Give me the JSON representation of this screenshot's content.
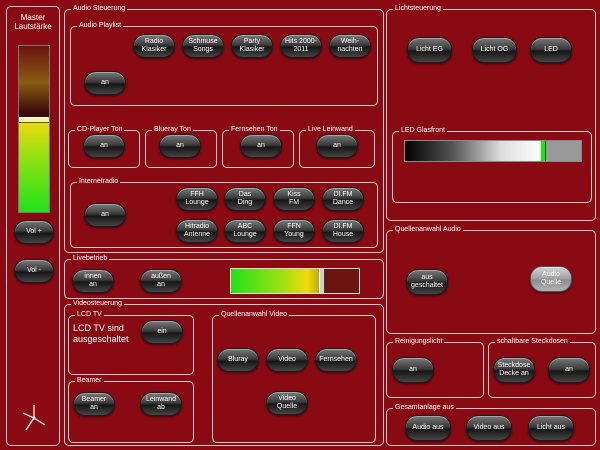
{
  "master": {
    "title": "Master\nLautstärke",
    "volume_level": 0.55,
    "vol_plus": "Vol +",
    "vol_minus": "Vol -"
  },
  "audio": {
    "title": "Audio Steuerung",
    "playlist": {
      "title": "Audio Playlist",
      "buttons": [
        "Radio\nKlasiker",
        "Schmuse\nSongs",
        "Party\nKlasiker",
        "Hits 2000-\n2011",
        "Weih-\nnachten"
      ],
      "on": "an"
    },
    "cd": {
      "title": "CD-Player Ton",
      "on": "an"
    },
    "bluray": {
      "title": "Blueray Ton",
      "on": "an"
    },
    "tv": {
      "title": "Fernsehen Ton",
      "on": "an"
    },
    "wall": {
      "title": "Live Leinwand",
      "on": "an"
    },
    "radio": {
      "title": "Internetradio",
      "on": "an",
      "buttons": [
        "FFH\nLounge",
        "Das\nDing",
        "Kiss\nFM",
        "DI.FM\nDance",
        "Hitradio\nAntenne",
        "ABC\nLounge",
        "FFN\nYoung",
        "DI.FM\nHouse"
      ]
    }
  },
  "live": {
    "title": "Livebetrieb",
    "inside": "innen\nan",
    "outside": "außen\nan",
    "level": 0.7
  },
  "video": {
    "title": "Videosteuerung",
    "lcd": {
      "title": "LCD TV",
      "status": "LCD TV sind\nausgeschaltet",
      "on": "ein"
    },
    "beamer": {
      "title": "Beamer",
      "on": "Beamer\nan",
      "screen": "Leinwand\nab"
    },
    "source": {
      "title": "Quellenanwahl Video",
      "buttons": [
        "Bluray",
        "Video",
        "Fernsehen",
        "Video\nQuelle"
      ]
    }
  },
  "light": {
    "title": "Lichtsteuerung",
    "buttons": [
      "Licht EG",
      "Licht OG",
      "LED"
    ],
    "glass": {
      "title": "LED Glasfront",
      "level": 0.78
    }
  },
  "audio_source": {
    "title": "Quellenanwahl Audio",
    "off": "aus\ngeschaltet",
    "source": "Audio\nQuelle"
  },
  "cleaning": {
    "title": "Reinigungslicht",
    "on": "an"
  },
  "sockets": {
    "title": "schaltbare Steckdosen",
    "ceiling": "Steckdose\nDecke an",
    "on": "an"
  },
  "total_off": {
    "title": "Gesamtanlage aus",
    "buttons": [
      "Audio aus",
      "Video aus",
      "Licht aus"
    ]
  },
  "colors": {
    "background": "#8a0a14",
    "border": "#e9c9cc",
    "meter_green": "#21e21a",
    "meter_yellow": "#f2d90a",
    "meter_dark": "#6b1410"
  }
}
